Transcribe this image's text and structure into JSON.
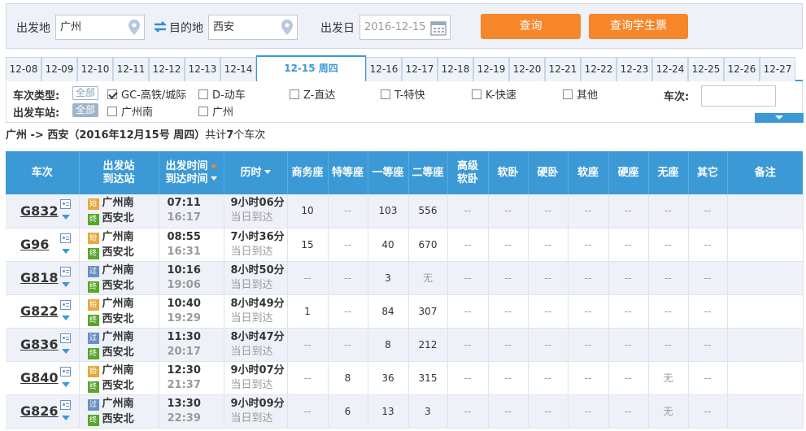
{
  "search": {
    "from_label": "出发地",
    "from_value": "广州",
    "to_label": "目的地",
    "to_value": "西安",
    "date_label": "出发日",
    "date_value": "2016-12-15",
    "query_button": "查询",
    "student_button": "查询学生票"
  },
  "date_tabs": [
    "12-08",
    "12-09",
    "12-10",
    "12-11",
    "12-12",
    "12-13",
    "12-14",
    "12-15 周四",
    "12-16",
    "12-17",
    "12-18",
    "12-19",
    "12-20",
    "12-21",
    "12-22",
    "12-23",
    "12-24",
    "12-25",
    "12-26",
    "12-27"
  ],
  "active_tab": "12-15 周四",
  "filters": {
    "type_label": "车次类型:",
    "station_label": "出发车站:",
    "all": "全部",
    "types": [
      "GC-高铁/城际",
      "D-动车",
      "Z-直达",
      "T-特快",
      "K-快速",
      "其他"
    ],
    "stations": [
      "广州南",
      "广州"
    ],
    "train_no_label": "车次:"
  },
  "summary": {
    "route": "广州 -> 西安（2016年12月15号  周四）",
    "count_text": "共计",
    "count": "7",
    "count_suffix": "个车次"
  },
  "headers": {
    "train": "车次",
    "stations_1": "出发站",
    "stations_2": "到达站",
    "times_1": "出发时间",
    "times_2": "到达时间",
    "duration": "历时",
    "business": "商务座",
    "premium": "特等座",
    "first": "一等座",
    "second": "二等座",
    "hsoft_1": "高级",
    "hsoft_2": "软卧",
    "soft_sleeper": "软卧",
    "hard_sleeper": "硬卧",
    "soft_seat": "软座",
    "hard_seat": "硬座",
    "no_seat": "无座",
    "other": "其它",
    "remark": "备注"
  },
  "rows": [
    {
      "code": "G832",
      "from_tag": "始",
      "from": "广州南",
      "to_tag": "终",
      "to": "西安北",
      "dep": "07:11",
      "arr": "16:17",
      "dur": "9小时06分",
      "day": "当日到达",
      "seats": [
        "10",
        "--",
        "103",
        "556",
        "--",
        "--",
        "--",
        "--",
        "--",
        "--",
        "--",
        ""
      ]
    },
    {
      "code": "G96",
      "from_tag": "始",
      "from": "广州南",
      "to_tag": "终",
      "to": "西安北",
      "dep": "08:55",
      "arr": "16:31",
      "dur": "7小时36分",
      "day": "当日到达",
      "seats": [
        "15",
        "--",
        "40",
        "670",
        "--",
        "--",
        "--",
        "--",
        "--",
        "--",
        "--",
        ""
      ]
    },
    {
      "code": "G818",
      "from_tag": "过",
      "from": "广州南",
      "to_tag": "终",
      "to": "西安北",
      "dep": "10:16",
      "arr": "19:06",
      "dur": "8小时50分",
      "day": "当日到达",
      "seats": [
        "--",
        "--",
        "3",
        "无",
        "--",
        "--",
        "--",
        "--",
        "--",
        "--",
        "--",
        ""
      ]
    },
    {
      "code": "G822",
      "from_tag": "始",
      "from": "广州南",
      "to_tag": "终",
      "to": "西安北",
      "dep": "10:40",
      "arr": "19:29",
      "dur": "8小时49分",
      "day": "当日到达",
      "seats": [
        "1",
        "--",
        "84",
        "307",
        "--",
        "--",
        "--",
        "--",
        "--",
        "--",
        "--",
        ""
      ]
    },
    {
      "code": "G836",
      "from_tag": "过",
      "from": "广州南",
      "to_tag": "终",
      "to": "西安北",
      "dep": "11:30",
      "arr": "20:17",
      "dur": "8小时47分",
      "day": "当日到达",
      "seats": [
        "--",
        "--",
        "8",
        "212",
        "--",
        "--",
        "--",
        "--",
        "--",
        "--",
        "--",
        ""
      ]
    },
    {
      "code": "G840",
      "from_tag": "始",
      "from": "广州南",
      "to_tag": "终",
      "to": "西安北",
      "dep": "12:30",
      "arr": "21:37",
      "dur": "9小时07分",
      "day": "当日到达",
      "seats": [
        "--",
        "8",
        "36",
        "315",
        "--",
        "--",
        "--",
        "--",
        "--",
        "无",
        "--",
        ""
      ]
    },
    {
      "code": "G826",
      "from_tag": "过",
      "from": "广州南",
      "to_tag": "终",
      "to": "西安北",
      "dep": "13:30",
      "arr": "22:39",
      "dur": "9小时09分",
      "day": "当日到达",
      "seats": [
        "--",
        "6",
        "13",
        "3",
        "--",
        "--",
        "--",
        "--",
        "--",
        "无",
        "--",
        ""
      ]
    }
  ],
  "colors": {
    "accent": "#3b99d6",
    "button": "#f5862a"
  }
}
